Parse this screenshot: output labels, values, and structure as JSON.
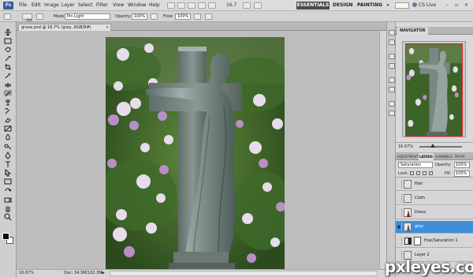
{
  "app": {
    "logo": "Ps"
  },
  "menu": {
    "items": [
      "File",
      "Edit",
      "Image",
      "Layer",
      "Select",
      "Filter",
      "View",
      "Window",
      "Help"
    ],
    "zoom_display": "16.7"
  },
  "workspaces": {
    "essentials": "ESSENTIALS",
    "design": "DESIGN",
    "painting": "PAINTING",
    "more": "»",
    "cs_live": "CS Live",
    "minimize": "–",
    "restore": "▫",
    "close": "×"
  },
  "options": {
    "brush_size": "104",
    "mode_label": "Mode:",
    "mode_value": "Pin Light",
    "opacity_label": "Opacity:",
    "opacity_value": "100%",
    "flow_label": "Flow:",
    "flow_value": "100%"
  },
  "document": {
    "tab_title": "grave.psd @ 16.7% (grey, RGB/8#)",
    "tab_close": "×"
  },
  "status": {
    "zoom": "16.67%",
    "doc_info": "Doc: 34.3M/102.3M",
    "arrow": "▶"
  },
  "navigator": {
    "tab": "NAVIGATOR",
    "zoom": "16.67%"
  },
  "layers_panel": {
    "tabs": [
      "ADJUSTMENTS",
      "LAYERS",
      "CHANNELS",
      "PATHS"
    ],
    "blend_mode": "Saturation",
    "opacity_label": "Opacity:",
    "opacity_value": "100%",
    "lock_label": "Lock:",
    "fill_label": "Fill:",
    "fill_value": "100%",
    "layers": [
      {
        "name": "Hair",
        "visible": false,
        "selected": false,
        "type": "pixel"
      },
      {
        "name": "Cloth",
        "visible": false,
        "selected": false,
        "type": "pixel"
      },
      {
        "name": "Dress",
        "visible": false,
        "selected": false,
        "type": "pixel"
      },
      {
        "name": "grey",
        "visible": true,
        "selected": true,
        "type": "pixel"
      },
      {
        "name": "Hue/Saturation 1",
        "visible": false,
        "selected": false,
        "type": "adjustment"
      },
      {
        "name": "Layer 2",
        "visible": false,
        "selected": false,
        "type": "pixel"
      }
    ]
  },
  "watermark": {
    "text": "pxleyes.com"
  },
  "colors": {
    "chrome": "#d4d4d4",
    "workspace": "#bdbdbd",
    "selection": "#3e8ed8",
    "essentials_bg": "#4a4a4a"
  }
}
